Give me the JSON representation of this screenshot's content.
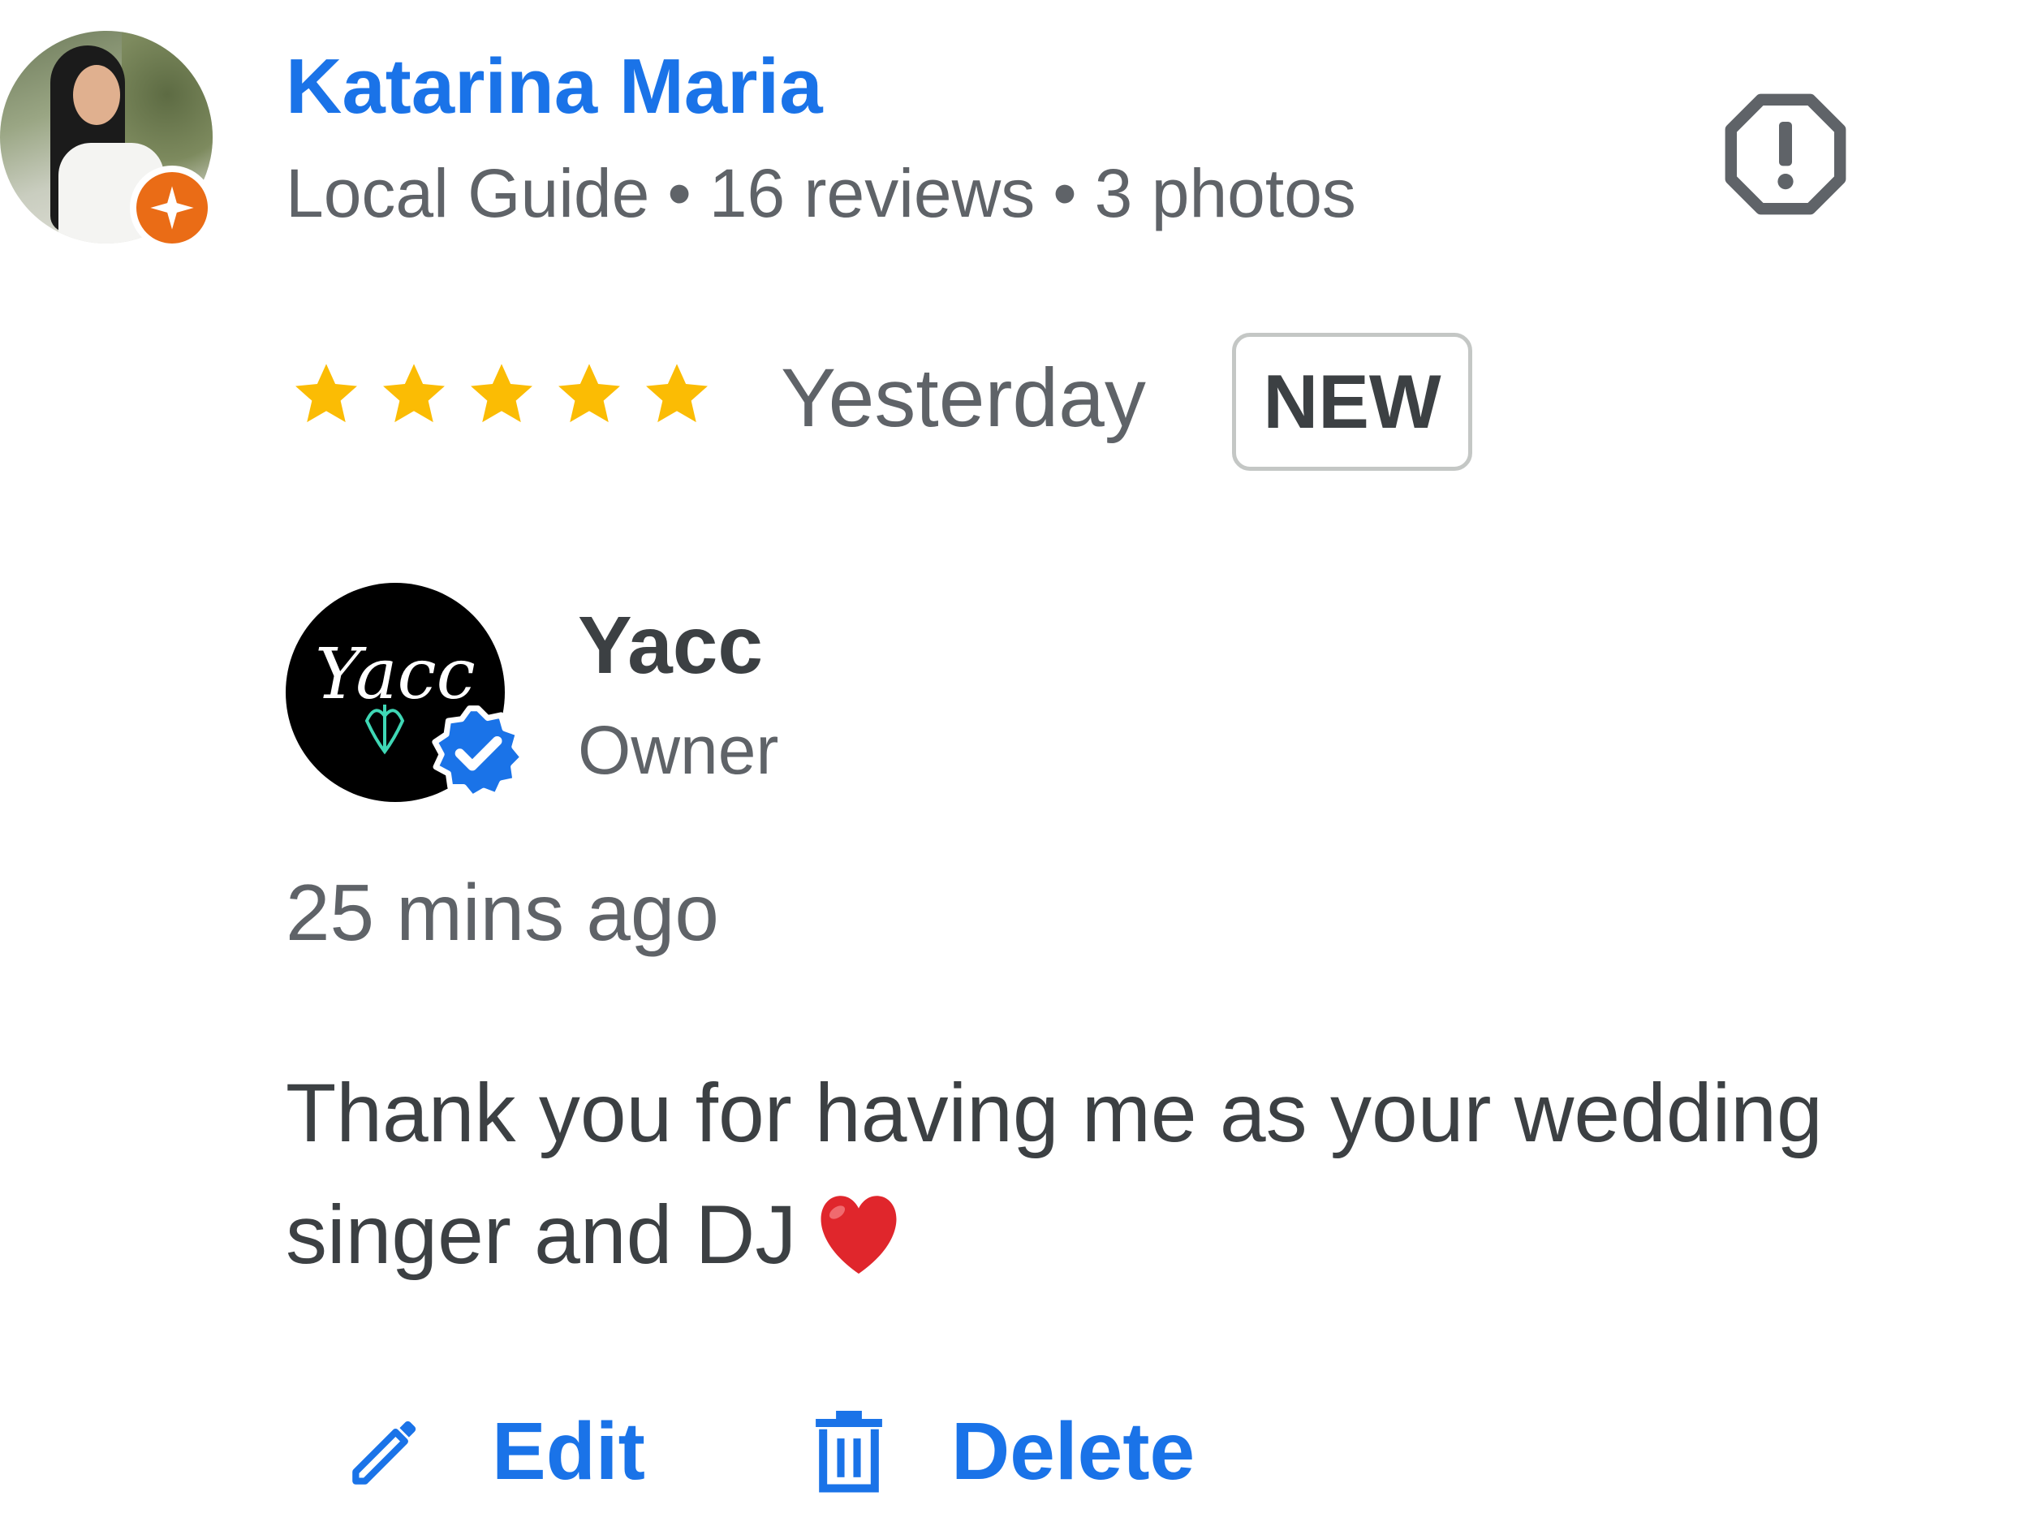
{
  "review": {
    "reviewer": {
      "name": "Katarina Maria",
      "badge": "Local Guide",
      "reviews": "16 reviews",
      "photos": "3 photos",
      "separator": "•",
      "badge_color": "#ea6c16"
    },
    "rating": 5,
    "date": "Yesterday",
    "new_label": "NEW"
  },
  "owner_response": {
    "name": "Yacc",
    "role": "Owner",
    "logo_text": "Yacc",
    "time": "25 mins ago",
    "text": "Thank you for having me as your wedding singer and DJ",
    "emoji": "heart-emoji"
  },
  "actions": {
    "edit_label": "Edit",
    "delete_label": "Delete"
  },
  "icons": {
    "report": "report-octagon-icon",
    "star": "star-icon",
    "edit": "pencil-icon",
    "delete": "trash-icon",
    "verified": "verified-check-icon"
  },
  "colors": {
    "accent": "#1a73e8",
    "star": "#fbbc04",
    "text": "#3c4043",
    "secondary": "#5f6368",
    "heart": "#e0262c"
  }
}
